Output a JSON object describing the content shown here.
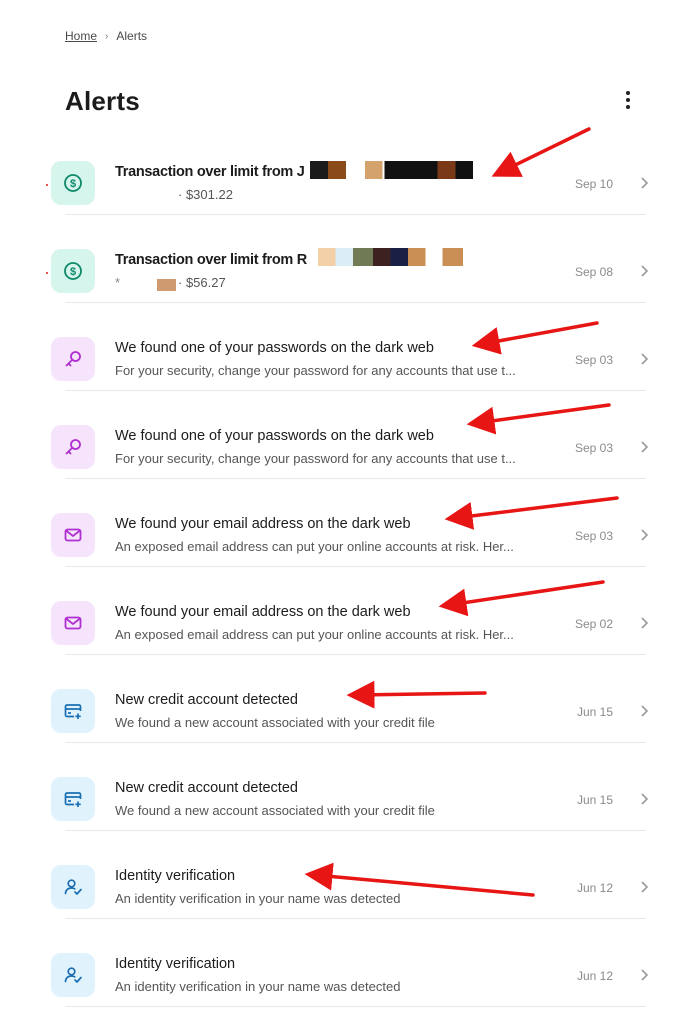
{
  "breadcrumb": {
    "home": "Home",
    "separator": "›",
    "current": "Alerts"
  },
  "page": {
    "title": "Alerts"
  },
  "alerts": [
    {
      "icon": "dollar-circle-icon",
      "title_prefix": "Transaction over limit from J",
      "sub": "· $301.22",
      "date": "Sep 10",
      "bold": true
    },
    {
      "icon": "dollar-circle-icon",
      "title_prefix": "Transaction over limit from R",
      "sub": "· $56.27",
      "sub_prefix": "*",
      "date": "Sep 08",
      "bold": true
    },
    {
      "icon": "key-icon",
      "title": "We found one of your passwords on the dark web",
      "sub": "For your security, change your password for any accounts that use t...",
      "date": "Sep 03"
    },
    {
      "icon": "key-icon",
      "title": "We found one of your passwords on the dark web",
      "sub": "For your security, change your password for any accounts that use t...",
      "date": "Sep 03"
    },
    {
      "icon": "mail-icon",
      "title": "We found your email address on the dark web",
      "sub": "An exposed email address can put your online accounts at risk. Her...",
      "date": "Sep 03"
    },
    {
      "icon": "mail-icon",
      "title": "We found your email address on the dark web",
      "sub": "An exposed email address can put your online accounts at risk. Her...",
      "date": "Sep 02"
    },
    {
      "icon": "credit-card-plus-icon",
      "title": "New credit account detected",
      "sub": "We found a new account associated with your credit file",
      "date": "Jun 15"
    },
    {
      "icon": "credit-card-plus-icon",
      "title": "New credit account detected",
      "sub": "We found a new account associated with your credit file",
      "date": "Jun 15"
    },
    {
      "icon": "user-check-icon",
      "title": "Identity verification",
      "sub": "An identity verification in your name was detected",
      "date": "Jun 12"
    },
    {
      "icon": "user-check-icon",
      "title": "Identity verification",
      "sub": "An identity verification in your name was detected",
      "date": "Jun 12"
    }
  ],
  "colors": {
    "money_bg": "#d6f5ec",
    "money_fg": "#0f8a6a",
    "key_bg": "#f5e4fb",
    "key_fg": "#b02fd1",
    "credit_bg": "#e0f2fc",
    "credit_fg": "#1a6fb0",
    "annotation_arrow": "#e81515"
  }
}
